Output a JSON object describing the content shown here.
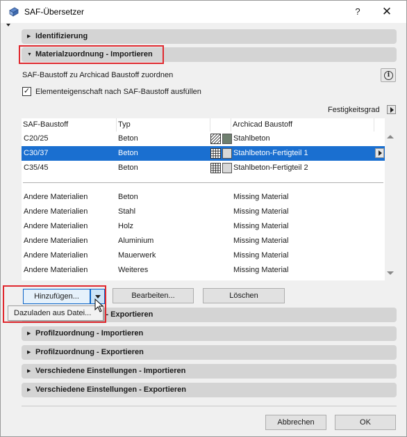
{
  "window": {
    "title": "SAF-Übersetzer",
    "help_label": "?",
    "close_label": "✕"
  },
  "sections": {
    "identifizierung": "Identifizierung",
    "material_import": "Materialzuordnung - Importieren",
    "material_export": "Materialzuordnung - Exportieren",
    "profil_import": "Profilzuordnung - Importieren",
    "profil_export": "Profilzuordnung - Exportieren",
    "versch_import": "Verschiedene Einstellungen - Importieren",
    "versch_export": "Verschiedene Einstellungen - Exportieren"
  },
  "material_import": {
    "description": "SAF-Baustoff zu Archicad Baustoff zuordnen",
    "checkbox_label": "Elementeigenschaft nach SAF-Baustoff ausfüllen",
    "checkbox_checked": true,
    "festigkeitsgrad_label": "Festigkeitsgrad"
  },
  "table": {
    "columns": [
      "SAF-Baustoff",
      "Typ",
      "Archicad Baustoff"
    ],
    "rows": [
      {
        "saf": "C20/25",
        "typ": "Beton",
        "archicad": "Stahlbeton",
        "hatch": "diagonal",
        "color": "#6f7f6f",
        "selected": false
      },
      {
        "saf": "C30/37",
        "typ": "Beton",
        "archicad": "Stahlbeton-Fertigteil 1",
        "hatch": "grid",
        "color": "#d8d8d8",
        "selected": true
      },
      {
        "saf": "C35/45",
        "typ": "Beton",
        "archicad": "Stahlbeton-Fertigteil 2",
        "hatch": "grid",
        "color": "#d8d8d8",
        "selected": false
      }
    ],
    "other_rows": [
      {
        "saf": "Andere Materialien",
        "typ": "Beton",
        "archicad": "Missing Material"
      },
      {
        "saf": "Andere Materialien",
        "typ": "Stahl",
        "archicad": "Missing Material"
      },
      {
        "saf": "Andere Materialien",
        "typ": "Holz",
        "archicad": "Missing Material"
      },
      {
        "saf": "Andere Materialien",
        "typ": "Aluminium",
        "archicad": "Missing Material"
      },
      {
        "saf": "Andere Materialien",
        "typ": "Mauerwerk",
        "archicad": "Missing Material"
      },
      {
        "saf": "Andere Materialien",
        "typ": "Weiteres",
        "archicad": "Missing Material"
      }
    ]
  },
  "buttons": {
    "hinzufuegen": "Hinzufügen...",
    "bearbeiten": "Bearbeiten...",
    "loeschen": "Löschen",
    "abbrechen": "Abbrechen",
    "ok": "OK"
  },
  "dropdown": {
    "item": "Dazuladen aus Datei..."
  },
  "colors": {
    "selection": "#1a6fd0",
    "highlight_box": "#e0282e",
    "section_header": "#d4d4d4"
  }
}
